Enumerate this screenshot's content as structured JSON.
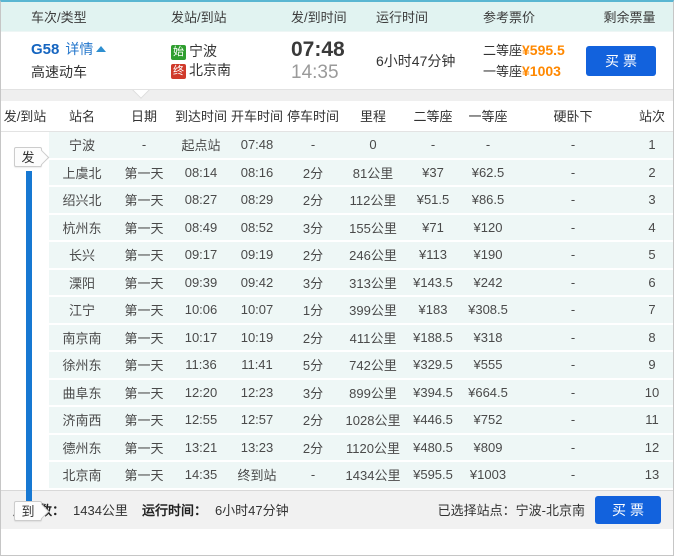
{
  "colors": {
    "buy_button": "#1262dd",
    "price_orange": "#ff8800",
    "origin_badge_green": "#2f9e2f",
    "dest_badge_red": "#d03a2b",
    "rail_blue": "#1778d2",
    "link_blue": "#2577cc",
    "band_cyan": "#e1f3f1",
    "row_cyan": "#eef7f6"
  },
  "summary": {
    "columns": [
      "车次/类型",
      "发站/到站",
      "发/到时间",
      "运行时间",
      "参考票价",
      "剩余票量"
    ],
    "train": {
      "code": "G58",
      "details_label": "详情",
      "type": "高速动车",
      "origin_badge": "始",
      "origin": "宁波",
      "dest_badge": "终",
      "dest": "北京南",
      "depart_time": "07:48",
      "arrive_time": "14:35",
      "duration": "6小时47分钟",
      "second_class_label": "二等座",
      "second_class_price": "¥595.5",
      "first_class_label": "一等座",
      "first_class_price": "¥1003",
      "buy_label": "买票"
    }
  },
  "stops": {
    "headers": [
      "发/到站",
      "站名",
      "日期",
      "到达时间",
      "开车时间",
      "停车时间",
      "里程",
      "二等座",
      "一等座",
      "硬卧下",
      "站次"
    ],
    "depart_tag": "发",
    "arrive_tag": "到",
    "rows": [
      [
        "宁波",
        "-",
        "起点站",
        "07:48",
        "-",
        "0",
        "-",
        "-",
        "-",
        "1"
      ],
      [
        "上虞北",
        "第一天",
        "08:14",
        "08:16",
        "2分",
        "81公里",
        "¥37",
        "¥62.5",
        "-",
        "2"
      ],
      [
        "绍兴北",
        "第一天",
        "08:27",
        "08:29",
        "2分",
        "112公里",
        "¥51.5",
        "¥86.5",
        "-",
        "3"
      ],
      [
        "杭州东",
        "第一天",
        "08:49",
        "08:52",
        "3分",
        "155公里",
        "¥71",
        "¥120",
        "-",
        "4"
      ],
      [
        "长兴",
        "第一天",
        "09:17",
        "09:19",
        "2分",
        "246公里",
        "¥113",
        "¥190",
        "-",
        "5"
      ],
      [
        "溧阳",
        "第一天",
        "09:39",
        "09:42",
        "3分",
        "313公里",
        "¥143.5",
        "¥242",
        "-",
        "6"
      ],
      [
        "江宁",
        "第一天",
        "10:06",
        "10:07",
        "1分",
        "399公里",
        "¥183",
        "¥308.5",
        "-",
        "7"
      ],
      [
        "南京南",
        "第一天",
        "10:17",
        "10:19",
        "2分",
        "411公里",
        "¥188.5",
        "¥318",
        "-",
        "8"
      ],
      [
        "徐州东",
        "第一天",
        "11:36",
        "11:41",
        "5分",
        "742公里",
        "¥329.5",
        "¥555",
        "-",
        "9"
      ],
      [
        "曲阜东",
        "第一天",
        "12:20",
        "12:23",
        "3分",
        "899公里",
        "¥394.5",
        "¥664.5",
        "-",
        "10"
      ],
      [
        "济南西",
        "第一天",
        "12:55",
        "12:57",
        "2分",
        "1028公里",
        "¥446.5",
        "¥752",
        "-",
        "11"
      ],
      [
        "德州东",
        "第一天",
        "13:21",
        "13:23",
        "2分",
        "1120公里",
        "¥480.5",
        "¥809",
        "-",
        "12"
      ],
      [
        "北京南",
        "第一天",
        "14:35",
        "终到站",
        "-",
        "1434公里",
        "¥595.5",
        "¥1003",
        "-",
        "13"
      ]
    ]
  },
  "footer": {
    "mileage_label": "里程数：",
    "mileage_value": "1434公里",
    "duration_label": "运行时间：",
    "duration_value": "6小时47分钟",
    "selected_label": "已选择站点：",
    "selected_value": "宁波-北京南",
    "buy_label": "买票"
  }
}
